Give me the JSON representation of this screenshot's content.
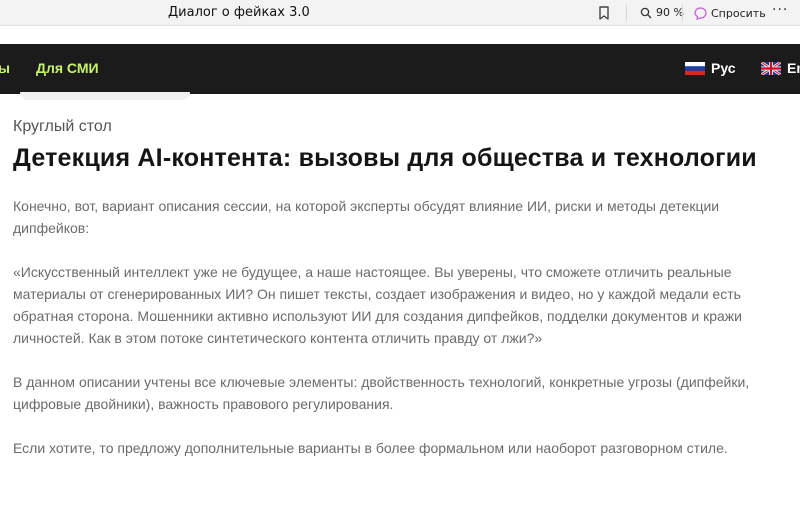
{
  "browser": {
    "tab_title": "Диалог о фейках 3.0",
    "zoom": "90 %",
    "ask_label": "Спросить",
    "more": "···"
  },
  "nav": {
    "items": [
      {
        "label": "ы"
      },
      {
        "label": "Для СМИ"
      }
    ],
    "languages": [
      {
        "label": "Рус",
        "flag": "russia"
      },
      {
        "label": "En",
        "flag": "uk"
      }
    ],
    "accent_color": "#c7f26b"
  },
  "article": {
    "kicker": "Круглый стол",
    "title": "Детекция AI-контента: вызовы для общества и технологии",
    "paragraphs": [
      "Конечно, вот, вариант описания сессии, на которой эксперты обсудят влияние ИИ, риски и методы детекции дипфейков:",
      "«Искусственный интеллект уже не будущее, а наше настоящее. Вы уверены, что сможете отличить реальные материалы от сгенерированных ИИ? Он пишет тексты, создает изображения и видео, но у каждой медали есть обратная сторона. Мошенники активно используют ИИ для создания дипфейков, подделки документов и кражи личностей. Как в этом потоке синтетического контента отличить правду от лжи?»",
      "В данном описании учтены все ключевые элементы: двойственность технологий, конкретные угрозы (дипфейки, цифровые двойники), важность правового регулирования.",
      "Если хотите, то предложу дополнительные варианты в более формальном или наоборот разговорном стиле."
    ]
  }
}
